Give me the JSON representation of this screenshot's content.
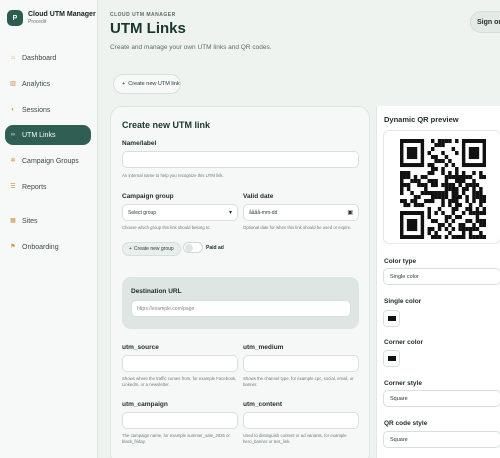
{
  "app": {
    "logo_letter": "P",
    "name": "Cloud UTM Manager",
    "subtitle": "Procedit"
  },
  "sidebar": {
    "items": [
      {
        "label": "Dashboard",
        "icon": "home-icon",
        "active": false
      },
      {
        "label": "Analytics",
        "icon": "chart-icon",
        "active": false
      },
      {
        "label": "Sessions",
        "icon": "pie-icon",
        "active": false
      },
      {
        "label": "UTM Links",
        "icon": "link-icon",
        "active": true
      },
      {
        "label": "Campaign Groups",
        "icon": "gear-icon",
        "active": false
      },
      {
        "label": "Reports",
        "icon": "list-icon",
        "active": false
      },
      {
        "label": "Sites",
        "icon": "grid-icon",
        "active": false
      },
      {
        "label": "Onboarding",
        "icon": "flag-icon",
        "active": false
      }
    ]
  },
  "header": {
    "eyebrow": "CLOUD UTM MANAGER",
    "title": "UTM Links",
    "subtitle": "Create and manage your own UTM links and QR codes.",
    "signout_label": "Sign out"
  },
  "actions": {
    "create_label": "Create new UTM link",
    "create_icon": "plus-icon"
  },
  "form": {
    "title": "Create new UTM link",
    "name_label": "Name/label",
    "name_value": "",
    "name_hint": "An internal name to help you recognize this UTM link.",
    "group_label": "Campaign group",
    "group_value": "Select group",
    "group_hint": "Choose which group this link should belong to.",
    "valid_label": "Valid date",
    "valid_placeholder": "åååå-mm-dd",
    "valid_hint": "Optional date for when this link should be used or expire.",
    "new_group_label": "Create new group",
    "paid_label": "Paid ad",
    "paid_on": false,
    "dest_label": "Destination URL",
    "dest_placeholder": "https://example.com/page",
    "source_label": "utm_source",
    "source_value": "",
    "source_hint": "Shows where the traffic comes from, for example Facebook, LinkedIn, or a newsletter.",
    "medium_label": "utm_medium",
    "medium_value": "",
    "medium_hint": "Shows the channel type, for example cpc, social, email, or banner.",
    "campaign_label": "utm_campaign",
    "campaign_value": "",
    "campaign_hint": "The campaign name, for example summer_sale_2026 or black_friday.",
    "content_label": "utm_content",
    "content_value": "",
    "content_hint": "Used to distinguish content or ad variants, for example hero_banner or text_link."
  },
  "qr": {
    "title": "Dynamic QR preview",
    "color_type_label": "Color type",
    "color_type_value": "Single color",
    "single_color_label": "Single color",
    "single_color": "#111111",
    "corner_color_label": "Corner color",
    "corner_color": "#111111",
    "corner_style_label": "Corner style",
    "corner_style_value": "Square",
    "code_style_label": "QR code style",
    "code_style_value": "Square"
  }
}
